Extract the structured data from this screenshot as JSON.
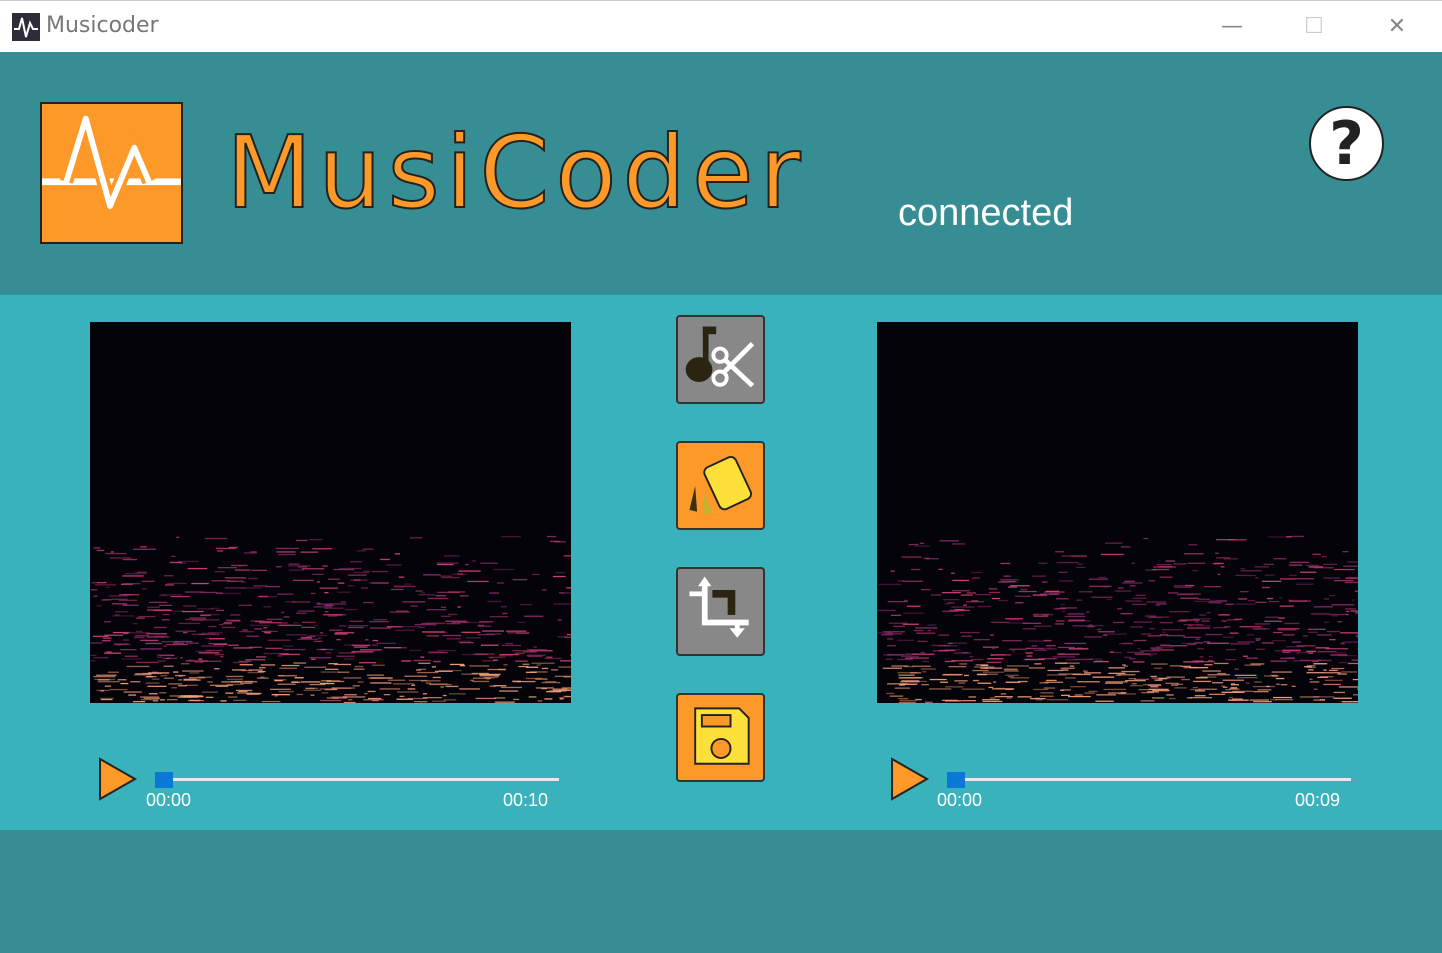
{
  "window": {
    "title": "Musicoder",
    "minimize": "—",
    "maximize": "☐",
    "close": "✕"
  },
  "header": {
    "brand": "MusiCoder",
    "status": "connected",
    "help_label": "?"
  },
  "colors": {
    "header": "#368e94",
    "content": "#3ab2bc",
    "accent": "#fc9929",
    "slider": "#0a78d7"
  },
  "tools": [
    {
      "icon": "music-cut-icon"
    },
    {
      "icon": "style-swatch-icon"
    },
    {
      "icon": "crop-icon"
    },
    {
      "icon": "save-icon"
    }
  ],
  "players": [
    {
      "current": "00:00",
      "total": "00:10",
      "progress": 0
    },
    {
      "current": "00:00",
      "total": "00:09",
      "progress": 0
    }
  ]
}
